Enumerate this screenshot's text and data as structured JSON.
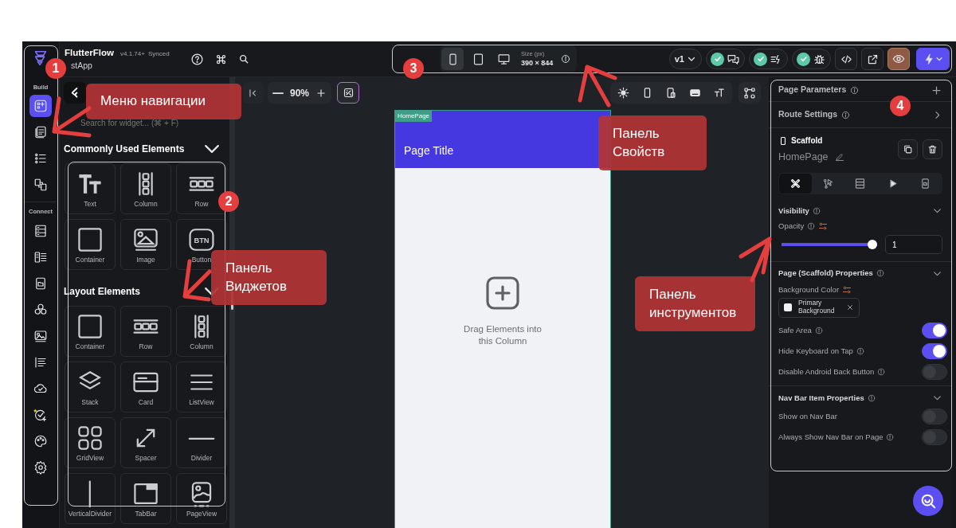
{
  "app": {
    "name": "FlutterFlow",
    "version": "v4.1.74+",
    "sync_status": "Synced",
    "project": "stApp"
  },
  "nav_rail": [
    {
      "label": "Build",
      "items": [
        {
          "kind": "add-widget",
          "selected": true
        },
        {
          "kind": "pages",
          "selected": false
        },
        {
          "kind": "tree",
          "selected": false
        },
        {
          "kind": "components",
          "selected": false
        }
      ]
    },
    {
      "label": "Connect",
      "items": [
        {
          "kind": "database",
          "selected": false
        },
        {
          "kind": "schema",
          "selected": false
        },
        {
          "kind": "media",
          "selected": false
        },
        {
          "kind": "integrations",
          "selected": false
        },
        {
          "kind": "images",
          "selected": false
        },
        {
          "kind": "text",
          "selected": false
        },
        {
          "kind": "cloud",
          "selected": false
        },
        {
          "kind": "agents",
          "selected": false
        },
        {
          "kind": "theme",
          "selected": false
        },
        {
          "kind": "settings",
          "selected": false
        }
      ]
    }
  ],
  "device_selector": {
    "devices": [
      {
        "kind": "phone",
        "selected": true
      },
      {
        "kind": "tablet",
        "selected": false
      },
      {
        "kind": "desktop",
        "selected": false
      }
    ],
    "size_label": "Size (px)",
    "size": "390 × 844"
  },
  "top_actions": {
    "version": "v1",
    "checks": [
      {
        "kind": "comments",
        "passed": true
      },
      {
        "kind": "format",
        "passed": true
      },
      {
        "kind": "debug",
        "passed": true
      }
    ]
  },
  "widget_panel": {
    "search": {
      "placeholder": "Search for widget... (⌘ + F)"
    },
    "sections": [
      {
        "title": "Commonly Used Elements",
        "items": [
          {
            "kind": "text",
            "label": "Text"
          },
          {
            "kind": "column",
            "label": "Column"
          },
          {
            "kind": "row",
            "label": "Row"
          },
          {
            "kind": "container",
            "label": "Container"
          },
          {
            "kind": "image",
            "label": "Image"
          },
          {
            "kind": "button",
            "label": "Button",
            "icon_text": "BTN"
          }
        ]
      },
      {
        "title": "Layout Elements",
        "items": [
          {
            "kind": "container",
            "label": "Container"
          },
          {
            "kind": "row",
            "label": "Row"
          },
          {
            "kind": "column",
            "label": "Column"
          },
          {
            "kind": "stack",
            "label": "Stack"
          },
          {
            "kind": "card",
            "label": "Card"
          },
          {
            "kind": "listview",
            "label": "ListView"
          },
          {
            "kind": "gridview",
            "label": "GridView"
          },
          {
            "kind": "spacer",
            "label": "Spacer"
          },
          {
            "kind": "divider",
            "label": "Divider"
          },
          {
            "kind": "vdivider",
            "label": "VerticalDivider"
          },
          {
            "kind": "tabbar",
            "label": "TabBar"
          },
          {
            "kind": "pageview",
            "label": "PageView"
          }
        ]
      }
    ]
  },
  "canvas": {
    "zoom": "90%",
    "page_tag": "HomePage",
    "page_title": "Page Title",
    "empty_hint": "Drag Elements into this Column"
  },
  "properties": {
    "page_parameters": "Page Parameters",
    "route_settings": "Route Settings",
    "widget_type": "Scaffold",
    "widget_name": "HomePage",
    "tabs": [
      {
        "kind": "properties",
        "selected": true
      },
      {
        "kind": "actions",
        "selected": false
      },
      {
        "kind": "backend",
        "selected": false
      },
      {
        "kind": "animations",
        "selected": false
      },
      {
        "kind": "state",
        "selected": false
      }
    ],
    "visibility": {
      "title": "Visibility",
      "expanded": true,
      "opacity_label": "Opacity",
      "level": 1,
      "value": "1"
    },
    "page_props": {
      "title": "Page (Scaffold) Properties",
      "expanded": true,
      "background_label": "Background Color",
      "color_chip": "Primary Background",
      "toggles": [
        {
          "label": "Safe Area",
          "on": true,
          "info": true
        },
        {
          "label": "Hide Keyboard on Tap",
          "on": true,
          "info": true
        },
        {
          "label": "Disable Android Back Button",
          "on": false,
          "info": true
        }
      ]
    },
    "nav_bar": {
      "title": "Nav Bar Item Properties",
      "expanded": true,
      "toggles": [
        {
          "label": "Show on Nav Bar",
          "on": false,
          "info": false
        },
        {
          "label": "Always Show Nav Bar on Page",
          "on": false,
          "info": true
        }
      ]
    }
  },
  "annotations": {
    "callouts": [
      "Меню навигации",
      "Панель Виджетов",
      "Панель Свойств",
      "Панель инструментов"
    ],
    "steps": [
      "1",
      "2",
      "3",
      "4"
    ]
  }
}
